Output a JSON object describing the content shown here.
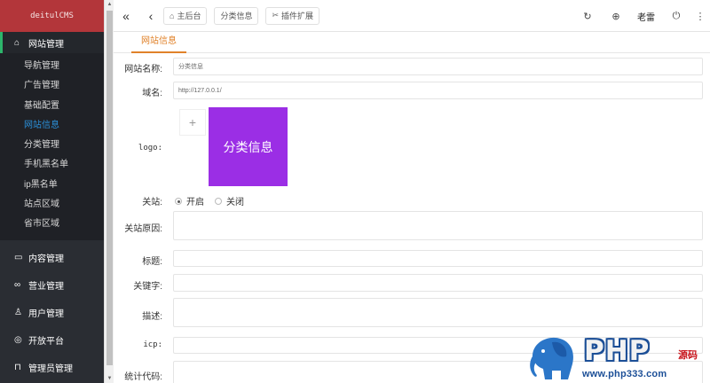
{
  "brand": "deitulCMS",
  "sidebar": {
    "open_group": {
      "label": "网站管理",
      "icon": "home-icon"
    },
    "items": [
      {
        "label": "导航管理",
        "active": false
      },
      {
        "label": "广告管理",
        "active": false
      },
      {
        "label": "基础配置",
        "active": false
      },
      {
        "label": "网站信息",
        "active": true
      },
      {
        "label": "分类管理",
        "active": false
      },
      {
        "label": "手机黑名单",
        "active": false
      },
      {
        "label": "ip黑名单",
        "active": false
      },
      {
        "label": "站点区域",
        "active": false
      },
      {
        "label": "省市区域",
        "active": false
      }
    ],
    "groups": [
      {
        "label": "内容管理",
        "icon": "card-icon"
      },
      {
        "label": "营业管理",
        "icon": "link-icon"
      },
      {
        "label": "用户管理",
        "icon": "user-icon"
      },
      {
        "label": "开放平台",
        "icon": "platform-icon"
      },
      {
        "label": "管理员管理",
        "icon": "lock-icon"
      }
    ]
  },
  "topbar": {
    "tabs": [
      {
        "label": "主后台",
        "icon": "home-icon"
      },
      {
        "label": "分类信息",
        "icon": ""
      },
      {
        "label": "插件扩展",
        "icon": "plugin-icon"
      }
    ],
    "user": "老雷"
  },
  "content": {
    "active_tab": "网站信息",
    "fields": {
      "site_name": {
        "label": "网站名称:",
        "value": "分类信息"
      },
      "domain": {
        "label": "域名:",
        "value": "http://127.0.0.1/"
      },
      "logo": {
        "label": "logo:",
        "logo_text": "分类信息"
      },
      "close_site": {
        "label": "关站:",
        "options": [
          "开启",
          "关闭"
        ],
        "selected": "开启"
      },
      "close_reason": {
        "label": "关站原因:"
      },
      "title": {
        "label": "标题:"
      },
      "keywords": {
        "label": "关键字:"
      },
      "description": {
        "label": "描述:"
      },
      "icp": {
        "label": "icp:"
      },
      "stats_code": {
        "label": "统计代码:"
      }
    }
  },
  "watermark": {
    "php": "PHP",
    "yuanma": "源码",
    "url": "www.php333.com"
  },
  "colors": {
    "sidebar": "#2a2d33",
    "brand_bg": "#b3363a",
    "accent_orange": "#e0822a",
    "active_link": "#2b8fd8",
    "logo_bg": "#9b2ee5"
  }
}
